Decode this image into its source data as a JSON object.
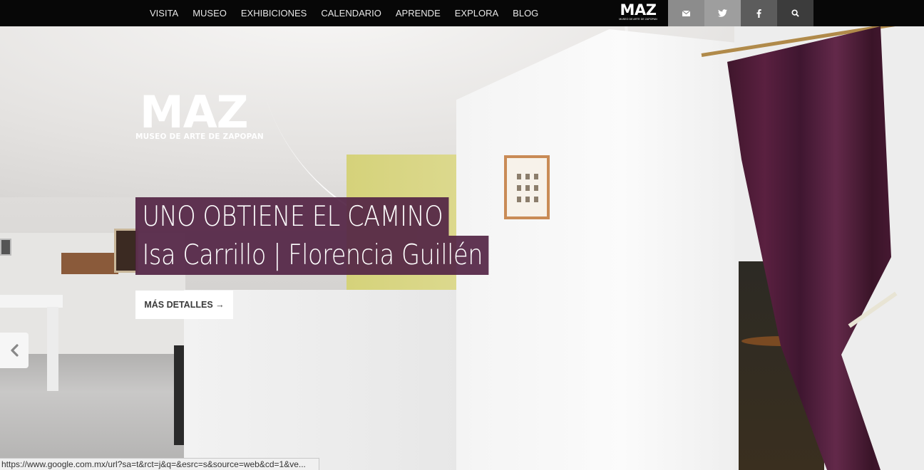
{
  "nav": {
    "items": [
      {
        "label": "VISITA"
      },
      {
        "label": "MUSEO"
      },
      {
        "label": "EXHIBICIONES"
      },
      {
        "label": "CALENDARIO"
      },
      {
        "label": "APRENDE"
      },
      {
        "label": "EXPLORA"
      },
      {
        "label": "BLOG"
      }
    ]
  },
  "logo": {
    "name": "MAZ",
    "subtitle": "MUSEO DE ARTE DE ZAPOPAN"
  },
  "social": [
    {
      "icon": "mail-icon",
      "color": "#8c8c8c"
    },
    {
      "icon": "twitter-icon",
      "color": "#9e9e9e"
    },
    {
      "icon": "facebook-icon",
      "color": "#5c5c5c"
    },
    {
      "icon": "search-icon",
      "color": "#3c3c3c"
    }
  ],
  "hero": {
    "title": "UNO OBTIENE EL CAMINO",
    "artists": "Isa Carrillo | Florencia Guillén",
    "button_label": "MÁS DETALLES →",
    "caption_color": "#522444",
    "prev_icon": "chevron-left-icon"
  },
  "statusbar": {
    "url": "https://www.google.com.mx/url?sa=t&rct=j&q=&esrc=s&source=web&cd=1&ve..."
  }
}
